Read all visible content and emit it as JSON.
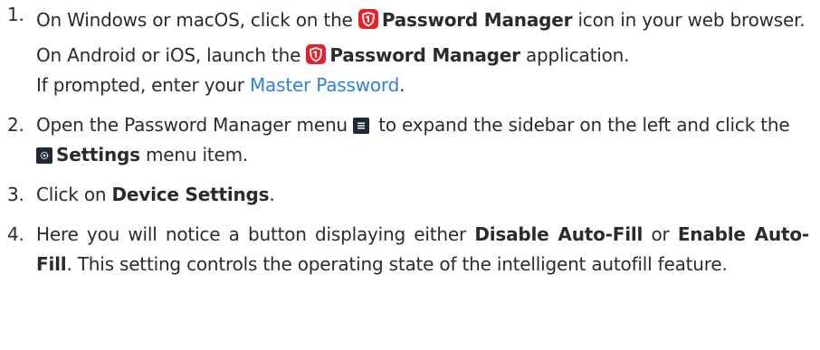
{
  "steps": [
    {
      "number": "1.",
      "p1": {
        "before": "On Windows or macOS, click on the ",
        "bold": "Password Manager",
        "after": " icon in your web browser."
      },
      "p2": {
        "before": "On Android or iOS, launch the ",
        "bold": "Password Manager",
        "after": " application."
      },
      "p3": {
        "before": "If prompted, enter your ",
        "link": "Master Password",
        "after": "."
      }
    },
    {
      "number": "2.",
      "before": "Open the Password Manager menu ",
      "middle": " to expand the sidebar on the left and click the ",
      "bold": "Settings",
      "after": " menu item."
    },
    {
      "number": "3.",
      "before": "Click on ",
      "bold": "Device Settings",
      "after": "."
    },
    {
      "number": "4.",
      "before": "Here you will notice a button displaying either ",
      "bold1": "Disable Auto-Fill",
      "middle": " or ",
      "bold2": "Enable Auto-Fill",
      "after": ". This setting controls the operating state of the intelligent autofill feature."
    }
  ],
  "colors": {
    "text": "#2b2b2b",
    "link": "#2d7fe0",
    "brand_red": "#e8202a",
    "menu_icon_bg": "#1f2a38",
    "settings_icon_bg": "#1f2a38"
  },
  "icons": {
    "password_manager": "shield-logo-icon",
    "menu": "hamburger-menu-icon",
    "settings": "gear-icon"
  }
}
